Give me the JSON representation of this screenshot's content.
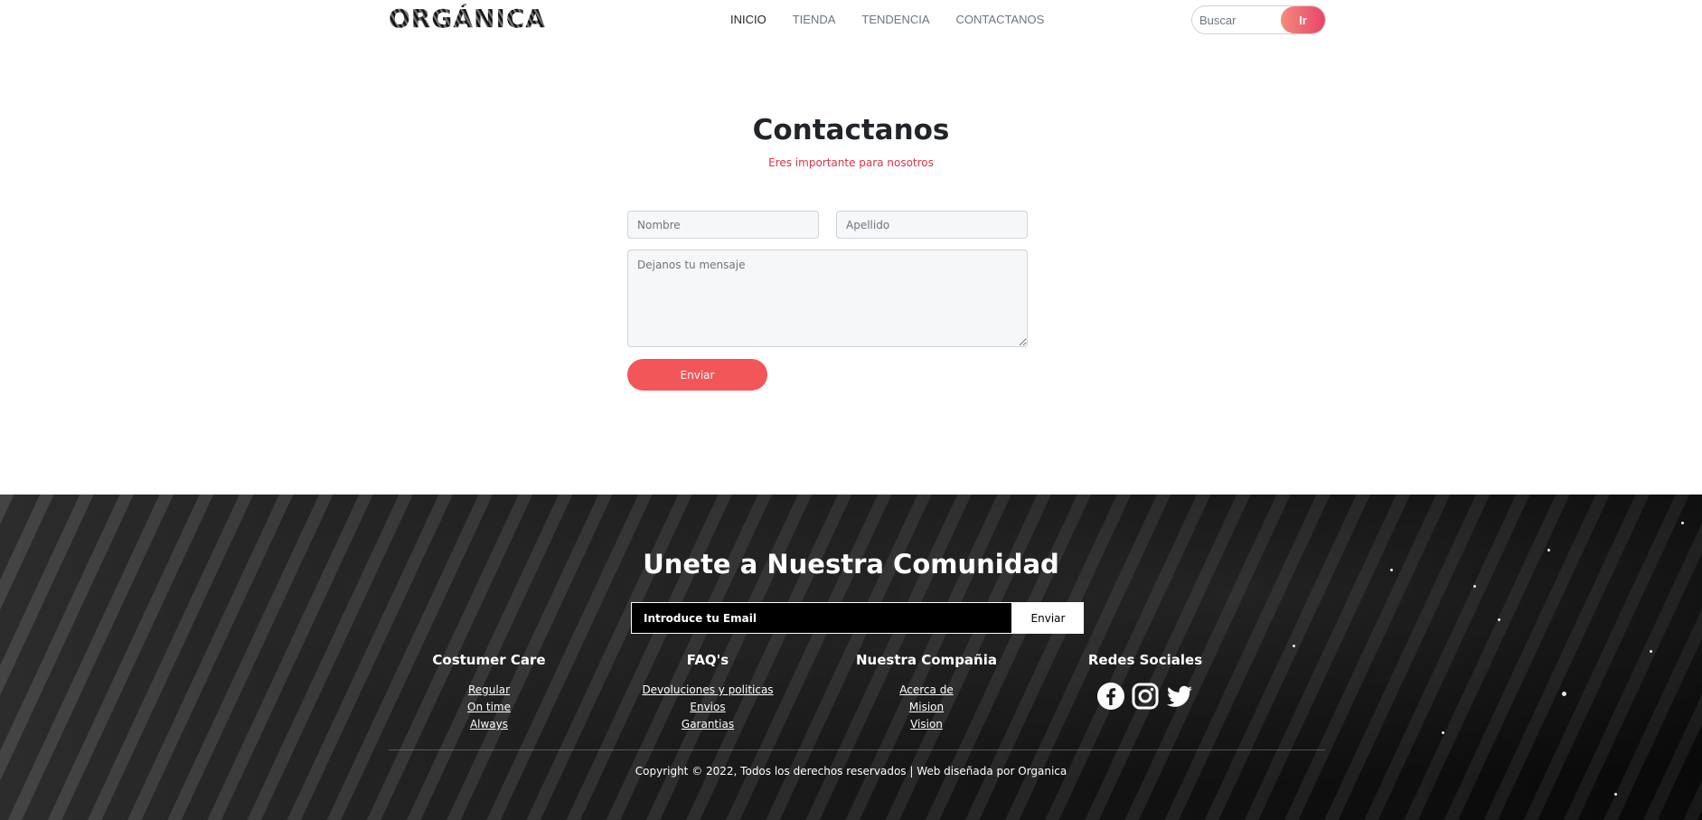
{
  "header": {
    "logo": "ORGÁNICA",
    "nav": [
      {
        "label": "INICIO"
      },
      {
        "label": "TIENDA"
      },
      {
        "label": "TENDENCIA"
      },
      {
        "label": "CONTACTANOS"
      }
    ],
    "search": {
      "placeholder": "Buscar",
      "button": "Ir"
    }
  },
  "contact": {
    "title": "Contactanos",
    "subtitle": "Eres importante para nosotros",
    "first_name_placeholder": "Nombre",
    "last_name_placeholder": "Apellido",
    "message_placeholder": "Dejanos tu mensaje",
    "submit": "Enviar"
  },
  "footer": {
    "title": "Unete a Nuestra Comunidad",
    "newsletter": {
      "placeholder": "Introduce tu Email",
      "button": "Enviar"
    },
    "columns": [
      {
        "heading": "Costumer Care",
        "links": [
          "Regular",
          "On time",
          "Always"
        ]
      },
      {
        "heading": "FAQ's",
        "links": [
          "Devoluciones y politicas",
          "Envios",
          "Garantias"
        ]
      },
      {
        "heading": "Nuestra Compañia",
        "links": [
          "Acerca de",
          "Mision",
          "Vision"
        ]
      }
    ],
    "social": {
      "heading": "Redes Sociales",
      "icons": [
        "facebook-icon",
        "instagram-icon",
        "twitter-icon"
      ]
    },
    "copyright": "Copyright © 2022, Todos los derechos reservados | Web diseñada por Organica"
  },
  "colors": {
    "accent": "#f25659",
    "subtitle": "#dc3545",
    "footer_bg": "#1a1a1a"
  }
}
